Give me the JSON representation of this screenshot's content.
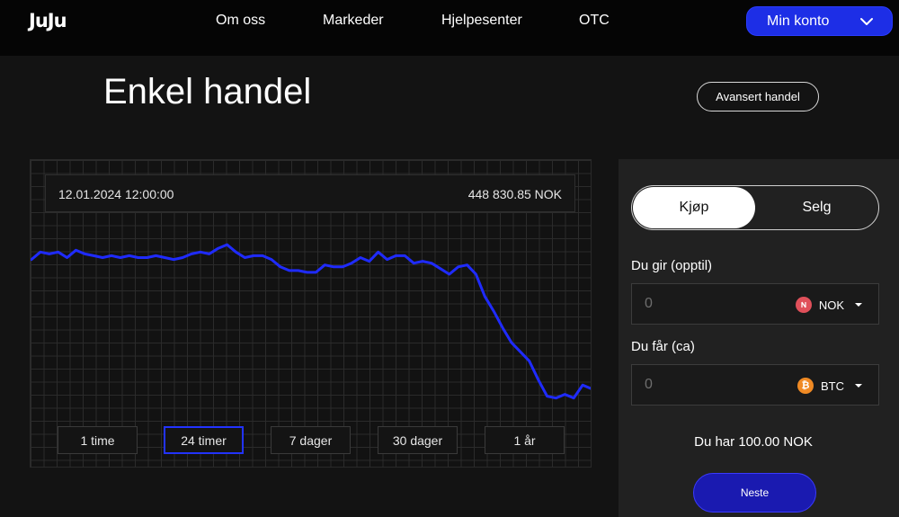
{
  "header": {
    "logo": "JuJu",
    "nav": [
      "Om oss",
      "Markeder",
      "Hjelpesenter",
      "OTC"
    ],
    "account_label": "Min konto"
  },
  "page": {
    "title": "Enkel handel",
    "advanced_label": "Avansert handel"
  },
  "chart": {
    "date": "12.01.2024 12:00:00",
    "price": "448 830.85 NOK",
    "line_color": "#1f2bff",
    "ranges": [
      "1 time",
      "24 timer",
      "7 dager",
      "30 dager",
      "1 år"
    ],
    "active_range": "24 timer"
  },
  "chart_data": {
    "type": "line",
    "title": "",
    "xlabel": "",
    "ylabel": "",
    "series": [
      {
        "values": [
          0.7,
          0.74,
          0.73,
          0.74,
          0.71,
          0.75,
          0.73,
          0.72,
          0.71,
          0.72,
          0.71,
          0.72,
          0.71,
          0.71,
          0.72,
          0.71,
          0.7,
          0.71,
          0.73,
          0.74,
          0.73,
          0.76,
          0.78,
          0.74,
          0.71,
          0.72,
          0.72,
          0.7,
          0.66,
          0.64,
          0.64,
          0.63,
          0.63,
          0.67,
          0.66,
          0.66,
          0.68,
          0.71,
          0.69,
          0.74,
          0.7,
          0.72,
          0.72,
          0.68,
          0.69,
          0.68,
          0.65,
          0.62,
          0.66,
          0.67,
          0.62,
          0.5,
          0.42,
          0.33,
          0.25,
          0.2,
          0.15,
          0.05,
          -0.04,
          -0.05,
          -0.03,
          -0.05,
          0.02,
          0.0
        ]
      }
    ]
  },
  "trade": {
    "buy_label": "Kjøp",
    "sell_label": "Selg",
    "give_label": "Du gir (opptil)",
    "give_placeholder": "0",
    "give_currency": "NOK",
    "give_color": "#e0505a",
    "get_label": "Du får (ca)",
    "get_placeholder": "0",
    "get_currency": "BTC",
    "get_color": "#f08a24",
    "balance": "Du har 100.00 NOK",
    "next_label": "Neste"
  }
}
